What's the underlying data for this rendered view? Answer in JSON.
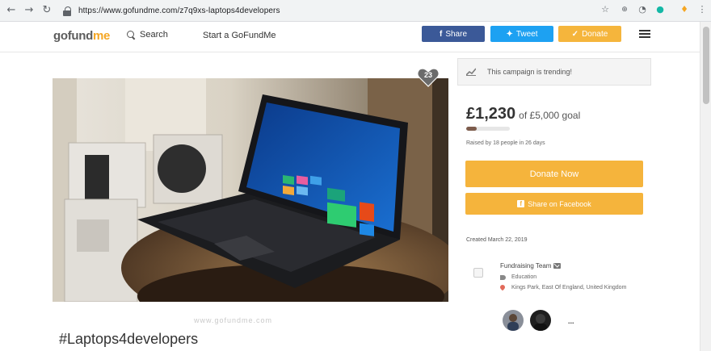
{
  "browser": {
    "url": "https://www.gofundme.com/z7q9xs-laptops4developers"
  },
  "header": {
    "logo_main": "gofund",
    "logo_accent": "me",
    "search_label": "Search",
    "start_link": "Start a GoFundMe",
    "share_label": "Share",
    "tweet_label": "Tweet",
    "donate_label": "Donate"
  },
  "campaign": {
    "title": "#Laptops4developers",
    "heart_count": "23",
    "watermark": "www.gofundme.com"
  },
  "sidebar": {
    "trending_text": "This campaign is trending!",
    "raised_amount": "£1,230",
    "raised_goal": "of £5,000 goal",
    "progress_fraction": 0.246,
    "raised_by": "Raised by 18 people in 26 days",
    "donate_now_label": "Donate Now",
    "share_facebook_label": "Share on Facebook",
    "created": "Created March 22, 2019",
    "team_name": "Fundraising Team",
    "category": "Education",
    "location": "Kings Park, East Of England, United Kingdom",
    "more": "..."
  },
  "colors": {
    "facebook": "#3b5998",
    "twitter": "#1da1f2",
    "donate": "#f5b43c",
    "progress": "#7d5c4c"
  },
  "icons": {
    "back": "arrow-left-icon",
    "forward": "arrow-right-icon",
    "reload": "reload-icon",
    "secure": "lock-icon",
    "star": "star-icon",
    "search": "search-icon",
    "menu": "hamburger-icon",
    "heart": "heart-icon",
    "trending": "trending-chart-icon",
    "email": "mail-icon",
    "category": "tag-icon",
    "location": "pin-icon"
  }
}
